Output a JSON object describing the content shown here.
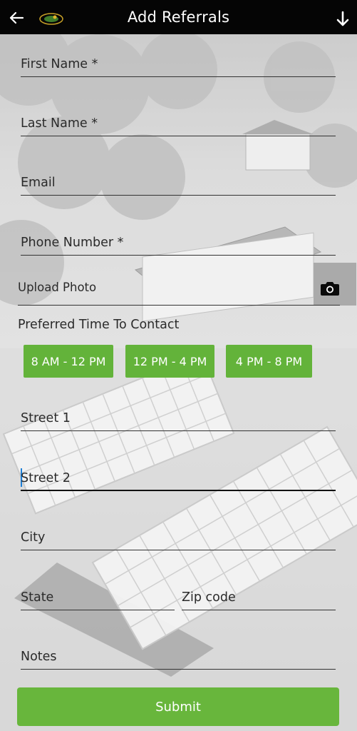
{
  "header": {
    "title": "Add Referrals"
  },
  "form": {
    "first_name": "First Name *",
    "last_name": "Last Name *",
    "email": "Email",
    "phone": "Phone Number *",
    "upload_photo": "Upload Photo",
    "preferred_time_title": "Preferred Time To Contact",
    "time_slots": [
      "8 AM - 12 PM",
      "12 PM - 4 PM",
      "4 PM - 8 PM"
    ],
    "street1": "Street 1",
    "street2": "Street 2",
    "city": "City",
    "state": "State",
    "zip": "Zip code",
    "notes": "Notes",
    "submit": "Submit"
  },
  "icons": {
    "back": "arrow-left-icon",
    "download": "arrow-down-icon",
    "camera": "camera-icon",
    "logo": "brand-logo"
  },
  "colors": {
    "header_bg": "#050505",
    "accent_green": "#63b33a",
    "caret": "#1e7fd6"
  }
}
